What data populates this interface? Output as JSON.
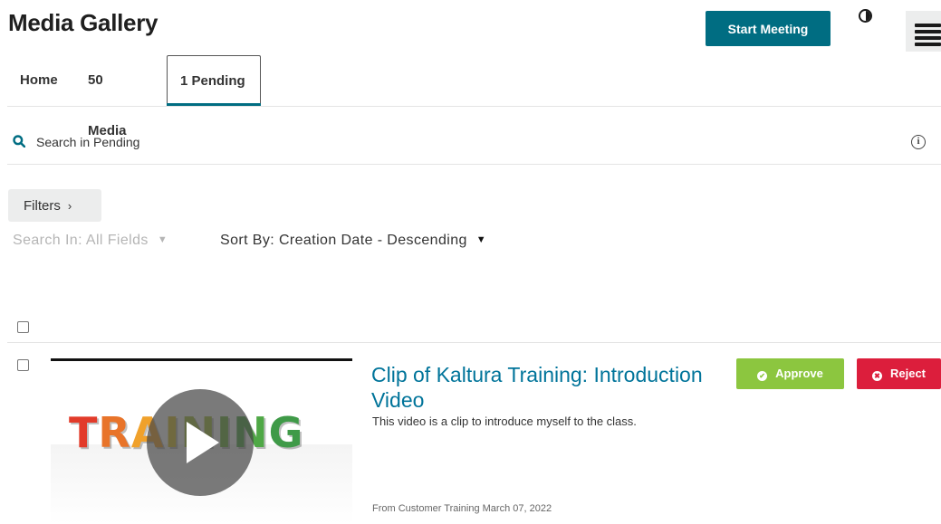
{
  "header": {
    "title": "Media Gallery",
    "start_meeting_label": "Start Meeting",
    "accent_color": "#006d82"
  },
  "tabs": [
    {
      "label": "Home",
      "active": false
    },
    {
      "label": "50 Media",
      "active": false
    },
    {
      "label": "1 Pending",
      "active": true
    }
  ],
  "search": {
    "placeholder": "Search in Pending",
    "value": ""
  },
  "filters": {
    "filters_label": "Filters",
    "search_in_label": "Search In: All Fields",
    "sort_by_label": "Sort By: Creation Date - Descending"
  },
  "entries": [
    {
      "title": "Clip of Kaltura Training: Introduction Video",
      "description": "This video is a clip to introduce myself to the class.",
      "meta": "From Customer Training March 07, 2022",
      "thumbnail_text": "TRAINING",
      "approve_label": "Approve",
      "reject_label": "Reject",
      "approve_color": "#8cc63f",
      "reject_color": "#dc1e3c"
    }
  ],
  "icons": {
    "search": "search-icon",
    "info": "info-icon",
    "contrast": "contrast-icon",
    "menu": "menu-icon",
    "play": "play-icon"
  }
}
